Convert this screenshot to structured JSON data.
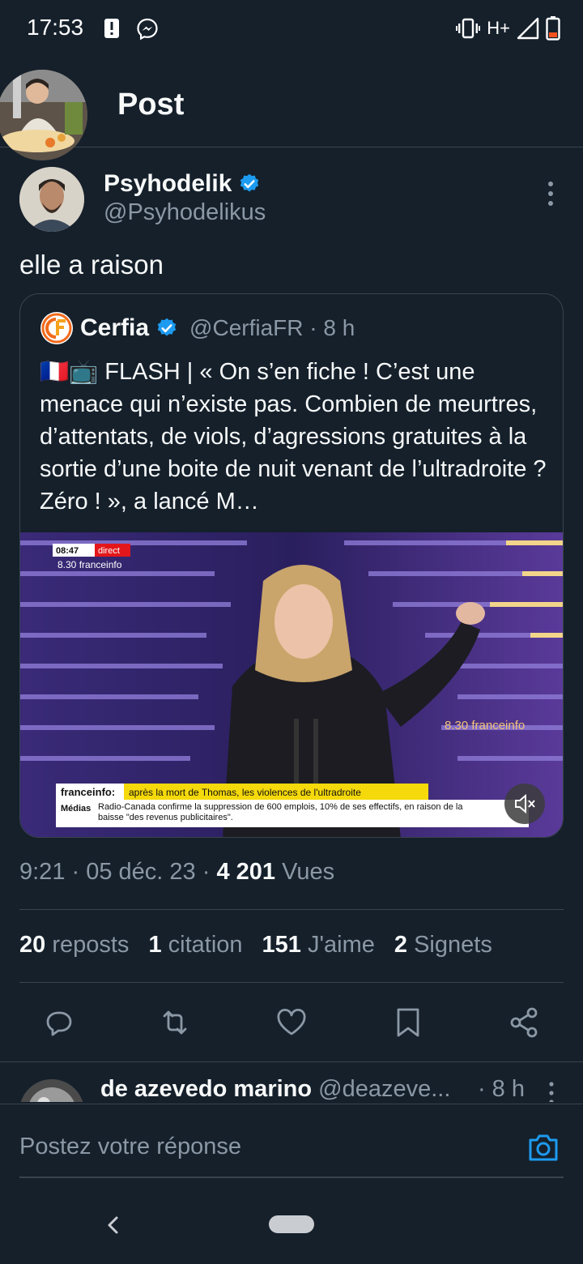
{
  "status_bar": {
    "time": "17:53",
    "network": "H+"
  },
  "header": {
    "title": "Post"
  },
  "post": {
    "author_name": "Psyhodelik",
    "author_handle": "@Psyhodelikus",
    "text": "elle a raison",
    "timestamp": "9:21 · 05 déc. 23 · ",
    "views_count": "4 201",
    "views_label": " Vues"
  },
  "quote": {
    "name": "Cerfia",
    "handle": "@CerfiaFR · 8 h",
    "text": "🇫🇷📺 FLASH | « On s’en fiche ! C’est une menace qui n’existe pas. Combien de meurtres, d’attentats, de viols, d’agressions gratuites à la sortie d’une boite de nuit venant de l’ultradroite ? Zéro ! », a lancé M…",
    "media": {
      "clock": "08:47",
      "live_tag": "direct",
      "show_top": "8.30 franceinfo",
      "show_right": "8.30 franceinfo",
      "banner_source": "franceinfo:",
      "banner_headline": "après la mort de Thomas, les violences de l'ultradroite",
      "ticker_label": "Médias",
      "ticker_text": "Radio-Canada confirme la suppression de 600 emplois, 10% de ses effectifs, en raison de la baisse \"des revenus publicitaires\"."
    }
  },
  "stats": [
    {
      "count": "20",
      "label": "reposts"
    },
    {
      "count": "1",
      "label": "citation"
    },
    {
      "count": "151",
      "label": "J'aime"
    },
    {
      "count": "2",
      "label": "Signets"
    }
  ],
  "reply_preview": {
    "name": "de azevedo marino",
    "handle": "@deazeve...",
    "time": "· 8 h"
  },
  "reply_box": {
    "placeholder": "Postez votre réponse"
  },
  "colors": {
    "background": "#15202b",
    "accent": "#1d9bf0",
    "muted": "#8b98a5"
  }
}
